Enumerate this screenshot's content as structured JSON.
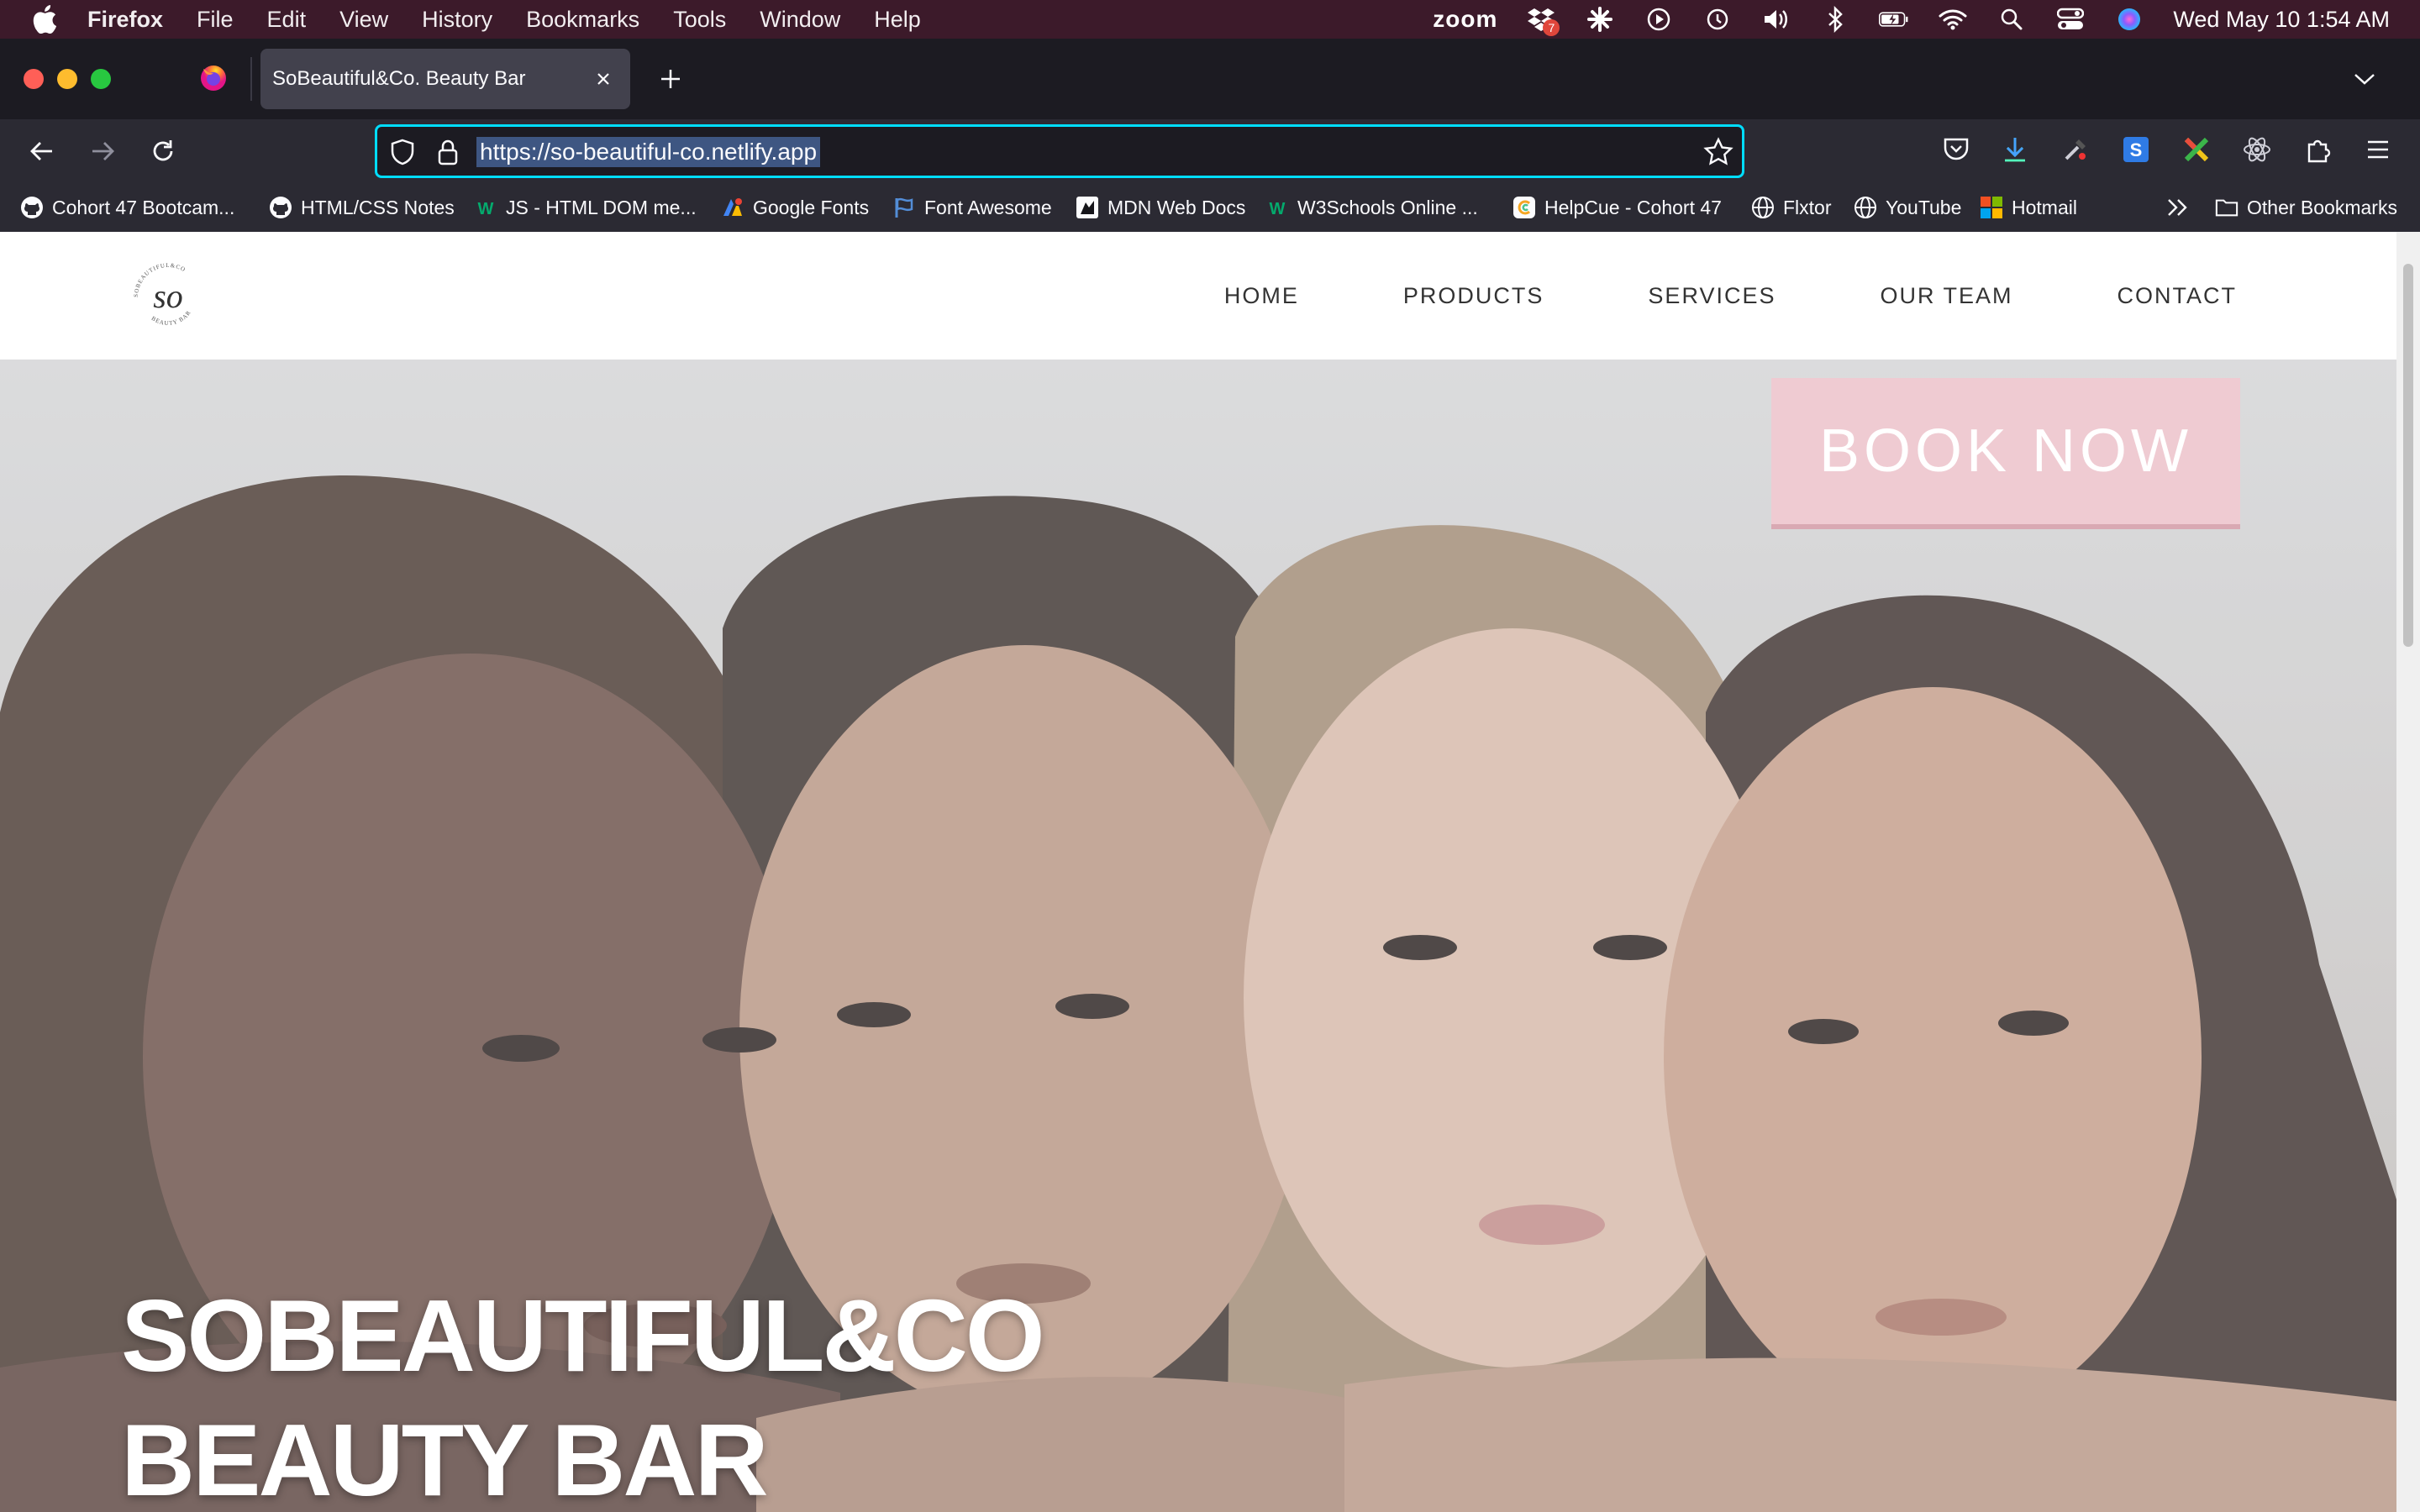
{
  "menubar": {
    "app_name": "Firefox",
    "menus": [
      "File",
      "Edit",
      "View",
      "History",
      "Bookmarks",
      "Tools",
      "Window",
      "Help"
    ],
    "zoom_label": "zoom",
    "notification_badge": "7",
    "clock": "Wed May 10  1:54 AM"
  },
  "browser": {
    "tab_title": "SoBeautiful&Co. Beauty Bar",
    "url": "https://so-beautiful-co.netlify.app"
  },
  "bookmarks": [
    {
      "label": "Cohort 47 Bootcam...",
      "icon": "github-icon"
    },
    {
      "label": "HTML/CSS Notes",
      "icon": "github-icon"
    },
    {
      "label": "JS - HTML DOM me...",
      "icon": "w3schools-icon"
    },
    {
      "label": "Google Fonts",
      "icon": "google-fonts-icon"
    },
    {
      "label": "Font Awesome",
      "icon": "font-awesome-icon"
    },
    {
      "label": "MDN Web Docs",
      "icon": "mdn-icon"
    },
    {
      "label": "W3Schools Online ...",
      "icon": "w3schools-icon"
    },
    {
      "label": "HelpCue - Cohort 47",
      "icon": "helpcue-icon"
    },
    {
      "label": "Flxtor",
      "icon": "globe-icon"
    },
    {
      "label": "YouTube",
      "icon": "globe-icon"
    },
    {
      "label": "Hotmail",
      "icon": "microsoft-icon"
    }
  ],
  "other_bookmarks": "Other Bookmarks",
  "site": {
    "nav": [
      "HOME",
      "PRODUCTS",
      "SERVICES",
      "OUR TEAM",
      "CONTACT"
    ],
    "book_now": "BOOK NOW",
    "hero_line1": "SOBEAUTIFUL&CO",
    "hero_line2": "BEAUTY BAR",
    "logo_monogram": "SO",
    "logo_ring_text": "SOBEAUTIFUL&CO BEAUTY BAR"
  },
  "colors": {
    "menubar_bg": "#3c1a2a",
    "url_focus": "#00ddff",
    "book_button": "#efcbd2"
  }
}
